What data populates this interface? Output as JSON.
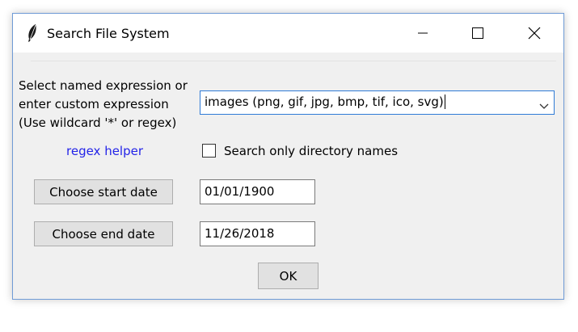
{
  "window": {
    "title": "Search File System",
    "icon": "feather-icon",
    "controls": [
      "minimize-icon",
      "maximize-icon",
      "close-icon"
    ]
  },
  "form": {
    "prompt_lines": [
      "Select named expression or",
      "enter custom expression",
      "(Use wildcard '*' or regex)"
    ],
    "expression_value": "images (png, gif, jpg, bmp, tif, ico, svg)",
    "regex_helper_label": "regex helper",
    "dir_only_label": "Search only directory names",
    "dir_only_checked": false,
    "start_date_button": "Choose start date",
    "start_date_value": "01/01/1900",
    "end_date_button": "Choose end date",
    "end_date_value": "11/26/2018",
    "ok_label": "OK"
  },
  "colors": {
    "link": "#2424e8",
    "focus_border": "#2f7bd6",
    "window_border": "#6f9bd6",
    "button_face": "#e1e1e1",
    "dialog_background": "#f0f0f0"
  }
}
